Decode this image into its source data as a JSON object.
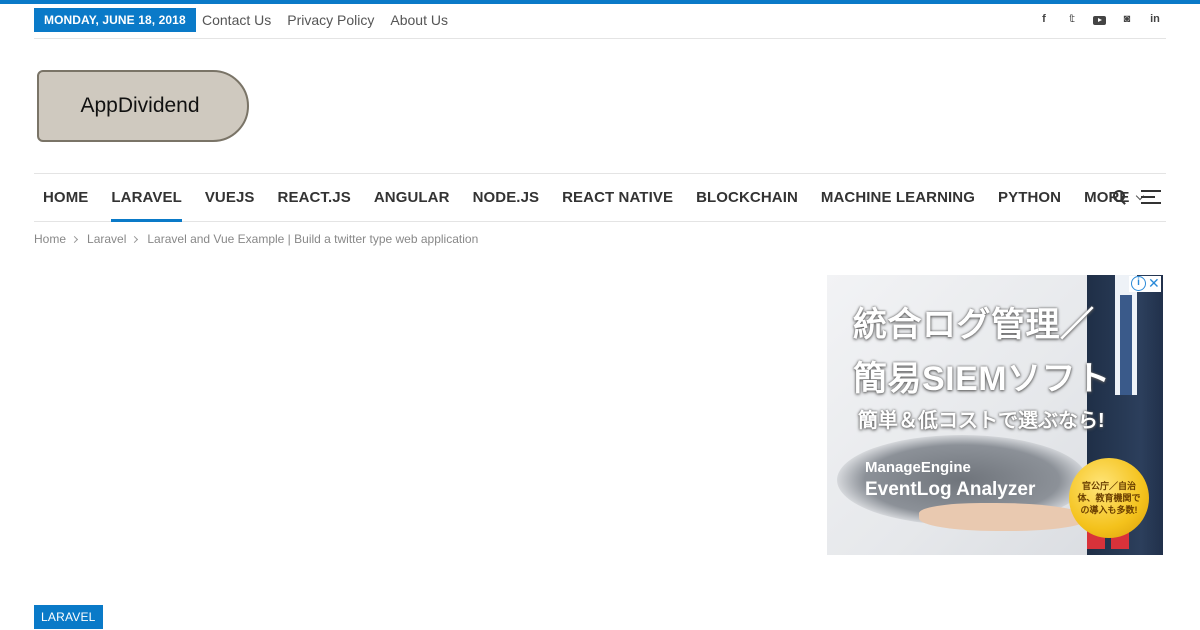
{
  "topbar": {
    "date": "MONDAY, JUNE 18, 2018",
    "links": [
      "Contact Us",
      "Privacy Policy",
      "About Us"
    ],
    "social_icons": [
      "facebook-icon",
      "twitter-icon",
      "youtube-icon",
      "github-icon",
      "linkedin-icon"
    ],
    "social_glyphs": {
      "facebook": "f",
      "twitter": "𝕥",
      "github": "◙",
      "linkedin": "in"
    }
  },
  "logo": {
    "text": "AppDividend"
  },
  "nav": {
    "items": [
      "HOME",
      "LARAVEL",
      "VUEJS",
      "REACT.JS",
      "ANGULAR",
      "NODE.JS",
      "REACT NATIVE",
      "BLOCKCHAIN",
      "MACHINE LEARNING",
      "PYTHON",
      "MORE"
    ],
    "active": "LARAVEL",
    "icons": [
      "search-icon",
      "menu-icon"
    ]
  },
  "breadcrumb": [
    "Home",
    "Laravel",
    "Laravel and Vue Example | Build a twitter type web application"
  ],
  "ad": {
    "line1": "統合ログ管理／",
    "line2": "簡易SIEMソフト",
    "line3": "簡単＆低コストで選ぶなら!",
    "brand1": "ManageEngine",
    "brand2": "EventLog Analyzer",
    "medal": "官公庁／自治体、教育機関での導入も多数!",
    "info": "i",
    "close": "✕"
  },
  "category_tag": "LARAVEL",
  "colors": {
    "accent": "#0a7ac8",
    "text": "#333333",
    "muted": "#888888"
  }
}
